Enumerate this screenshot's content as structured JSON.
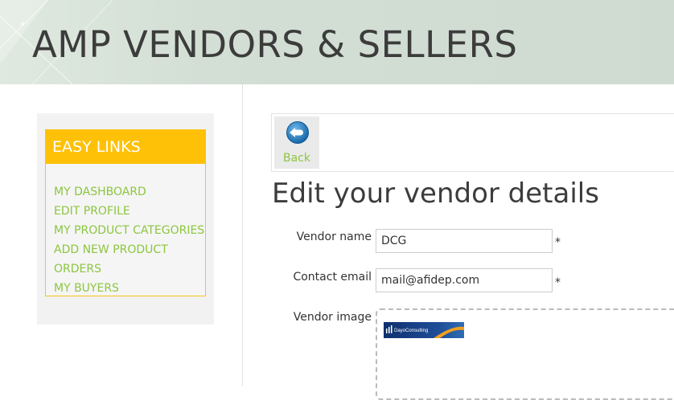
{
  "site": {
    "title": "AMP VENDORS & SELLERS"
  },
  "sidebar": {
    "heading": "EASY LINKS",
    "links": [
      {
        "label": "MY DASHBOARD"
      },
      {
        "label": "EDIT PROFILE"
      },
      {
        "label": "MY PRODUCT CATEGORIES"
      },
      {
        "label": "ADD NEW PRODUCT"
      },
      {
        "label": "ORDERS"
      },
      {
        "label": "MY BUYERS"
      }
    ]
  },
  "toolbar": {
    "back_label": "Back",
    "back_icon": "back-arrow-icon"
  },
  "page": {
    "title": "Edit your vendor details"
  },
  "form": {
    "vendor_name": {
      "label": "Vendor name",
      "value": "DCG",
      "required_mark": "*"
    },
    "contact_email": {
      "label": "Contact email",
      "value": "mail@afidep.com",
      "required_mark": "*"
    },
    "vendor_image": {
      "label": "Vendor image",
      "logo_text": "DayoConsulting"
    }
  },
  "colors": {
    "accent_green": "#8cc63f",
    "links_header": "#fec107",
    "header_bg": "#d3ded5",
    "back_icon_blue": "#1f7fc4"
  }
}
